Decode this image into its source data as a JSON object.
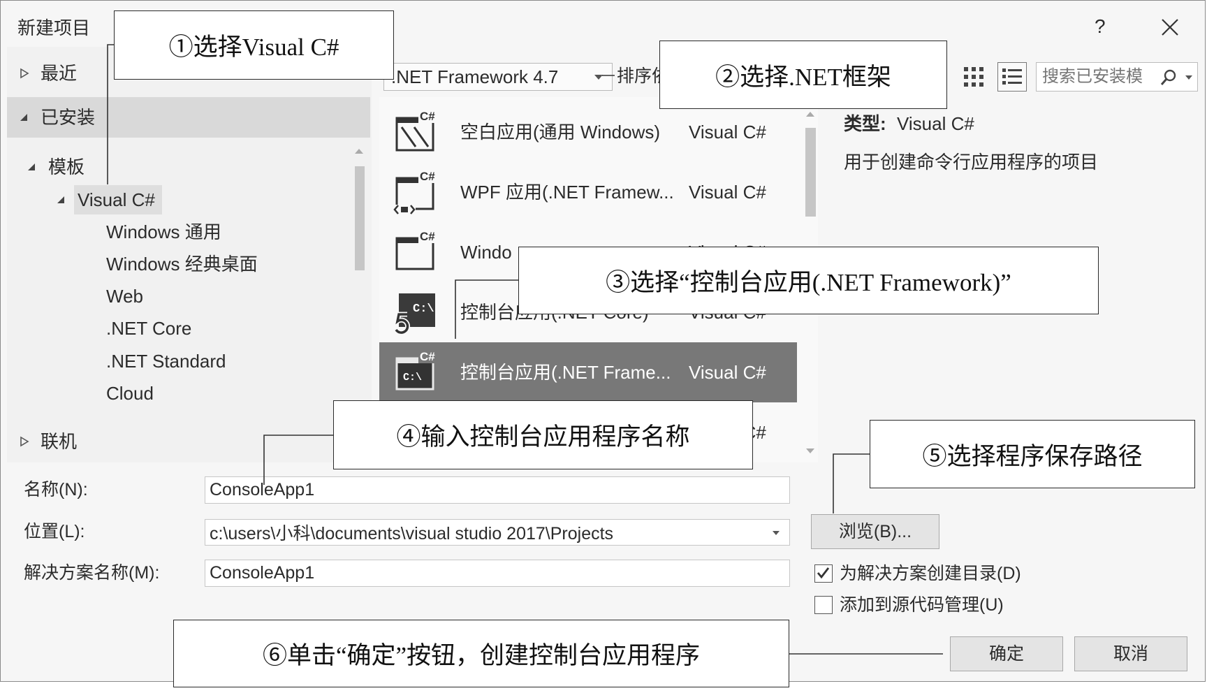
{
  "window": {
    "title": "新建项目",
    "help": "?"
  },
  "tree": {
    "recent": "最近",
    "installed": "已安装",
    "templates": "模板",
    "visual_csharp": "Visual C#",
    "subitems": [
      "Windows 通用",
      "Windows 经典桌面",
      "Web",
      ".NET Core",
      ".NET Standard",
      "Cloud"
    ],
    "online": "联机"
  },
  "toolbar": {
    "framework": ".NET Framework 4.7",
    "sort_label": "排序依",
    "search_placeholder": "搜索已安装模"
  },
  "icons": {
    "badge": "C#",
    "console_prompt": "C:\\"
  },
  "template_list": {
    "selected_index": 4,
    "items": [
      {
        "name": "空白应用(通用 Windows)",
        "lang": "Visual C#"
      },
      {
        "name": "WPF 应用(.NET Framew...",
        "lang": "Visual C#"
      },
      {
        "name": "Windo",
        "lang": "Visual C#"
      },
      {
        "name": "控制台应用(.NET Core)",
        "lang": "Visual C#"
      },
      {
        "name": "控制台应用(.NET Frame...",
        "lang": "Visual C#"
      },
      {
        "name": "",
        "lang": "Visual C#"
      }
    ]
  },
  "details": {
    "type_label": "类型:",
    "type_value": "Visual C#",
    "description": "用于创建命令行应用程序的项目"
  },
  "form": {
    "name_label": "名称(N):",
    "name_value": "ConsoleApp1",
    "location_label": "位置(L):",
    "location_value": "c:\\users\\小科\\documents\\visual studio 2017\\Projects",
    "solution_label": "解决方案名称(M):",
    "solution_value": "ConsoleApp1",
    "browse": "浏览(B)...",
    "create_dir": "为解决方案创建目录(D)",
    "create_dir_checked": true,
    "source_control": "添加到源代码管理(U)",
    "source_control_checked": false,
    "ok": "确定",
    "cancel": "取消"
  },
  "callouts": {
    "c1": "①选择Visual C#",
    "c2": "②选择.NET框架",
    "c3": "③选择“控制台应用(.NET Framework)”",
    "c4": "④输入控制台应用程序名称",
    "c5": "⑤选择程序保存路径",
    "c6": "⑥单击“确定”按钮，创建控制台应用程序"
  },
  "colors": {
    "dialog_bg": "#f6f6f6",
    "panel_bg": "#f1f1f1",
    "installed_band": "#d9d9d9",
    "tree_highlight": "#dedede",
    "list_bg": "#f9f9f9",
    "selected_bg": "#787878",
    "callout_border": "#2a2a2a"
  }
}
